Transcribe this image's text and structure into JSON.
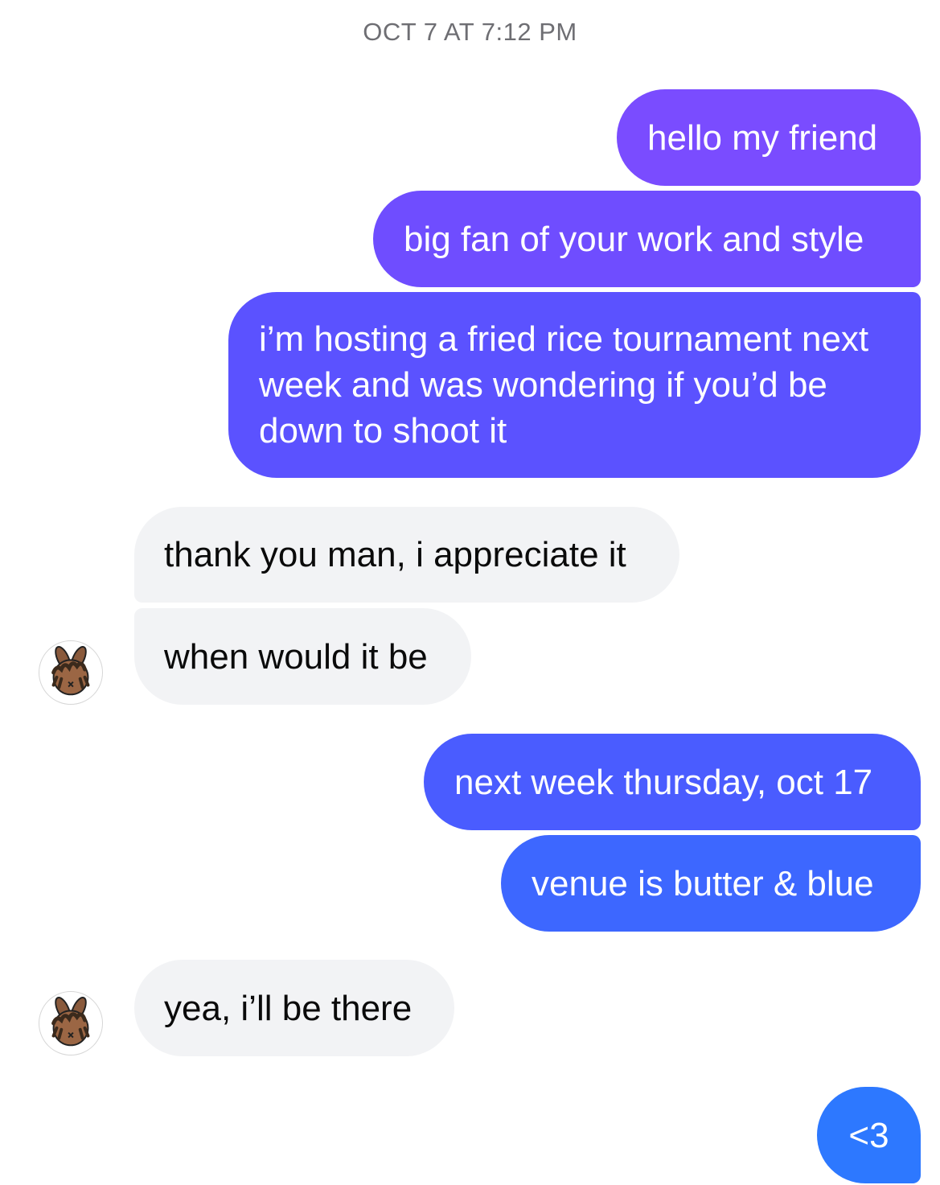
{
  "timestamp": "OCT 7 AT 7:12 PM",
  "messages": [
    {
      "sender": "me",
      "text": "hello my friend"
    },
    {
      "sender": "me",
      "text": "big fan of your work and style"
    },
    {
      "sender": "me",
      "text": "i’m hosting a fried rice tournament next week and was wondering if you’d be down to shoot it"
    },
    {
      "sender": "them",
      "text": "thank you man, i appreciate it"
    },
    {
      "sender": "them",
      "text": "when would it be"
    },
    {
      "sender": "me",
      "text": "next week thursday, oct 17"
    },
    {
      "sender": "me",
      "text": "venue is butter & blue"
    },
    {
      "sender": "them",
      "text": "yea, i’ll be there"
    },
    {
      "sender": "me",
      "text": "<3"
    }
  ],
  "avatar": {
    "icon": "bunny-avatar-icon"
  },
  "colors": {
    "outgoing_top": "#7a4cff",
    "outgoing_bottom": "#2d78ff",
    "incoming_bg": "#f2f3f5",
    "timestamp": "#6e6e73"
  }
}
